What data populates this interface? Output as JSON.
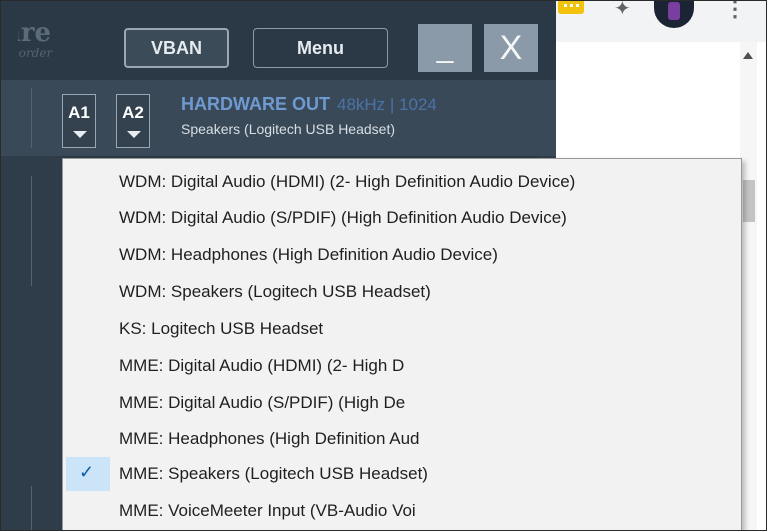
{
  "voicemeeter": {
    "logo_text": "are",
    "logo_subtext": "corder",
    "buttons": {
      "vban": "VBAN",
      "menu": "Menu",
      "minimize": "_",
      "close": "X"
    },
    "hardware_out": {
      "bus_a1": "A1",
      "bus_a2": "A2",
      "title": "HARDWARE OUT",
      "info": "48kHz | 1024",
      "device": "Speakers (Logitech USB Headset)"
    }
  },
  "browser": {
    "extension_icon": "yellow-extension-icon",
    "puzzle_icon": "puzzle-icon",
    "kebab": "⋮",
    "accent": "#f3c20a"
  },
  "dropdown": {
    "items": [
      {
        "label": "WDM: Digital Audio (HDMI) (2- High Definition Audio Device)",
        "selected": false
      },
      {
        "label": "WDM: Digital Audio (S/PDIF) (High Definition Audio Device)",
        "selected": false
      },
      {
        "label": "WDM: Headphones (High Definition Audio Device)",
        "selected": false
      },
      {
        "label": "WDM: Speakers (Logitech USB Headset)",
        "selected": false
      },
      {
        "label": "KS: Logitech USB Headset",
        "selected": false
      },
      {
        "label": "MME: Digital Audio (HDMI) (2- High D",
        "selected": false
      },
      {
        "label": "MME: Digital Audio (S/PDIF) (High De",
        "selected": false
      },
      {
        "label": "MME: Headphones (High Definition Aud",
        "selected": false
      },
      {
        "label": "MME: Speakers (Logitech USB Headset)",
        "selected": true
      },
      {
        "label": "MME: VoiceMeeter Input (VB-Audio Voi",
        "selected": false
      }
    ],
    "check_glyph": "✓"
  }
}
